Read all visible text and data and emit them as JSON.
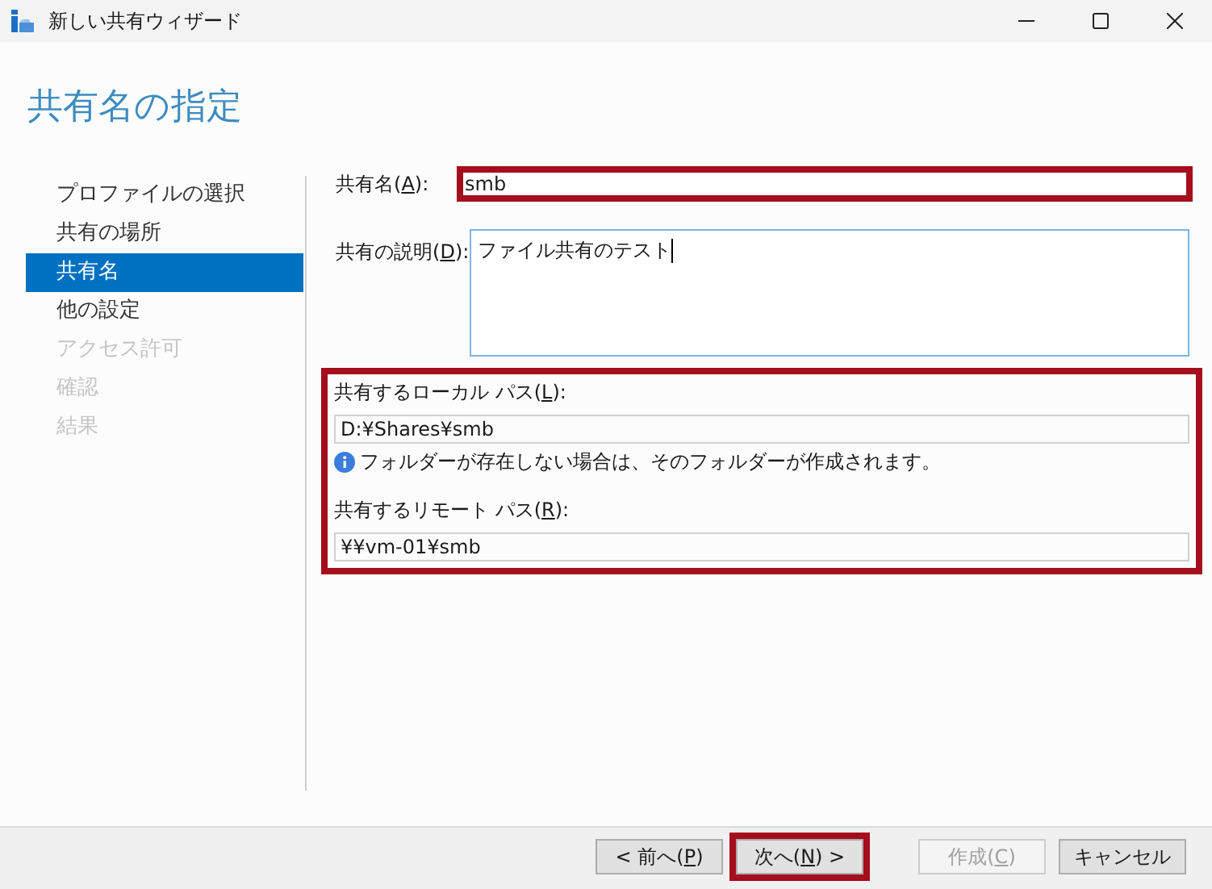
{
  "window": {
    "title": "新しい共有ウィザード"
  },
  "heading": "共有名の指定",
  "steps": [
    {
      "label": "プロファイルの選択",
      "selected": false,
      "disabled": false
    },
    {
      "label": "共有の場所",
      "selected": false,
      "disabled": false
    },
    {
      "label": "共有名",
      "selected": true,
      "disabled": false
    },
    {
      "label": "他の設定",
      "selected": false,
      "disabled": false
    },
    {
      "label": "アクセス許可",
      "selected": false,
      "disabled": true
    },
    {
      "label": "確認",
      "selected": false,
      "disabled": true
    },
    {
      "label": "結果",
      "selected": false,
      "disabled": true
    }
  ],
  "share_name": {
    "label": {
      "before": "共有名(",
      "key": "A",
      "after": "):"
    },
    "value": "smb",
    "highlighted": true
  },
  "description": {
    "label": {
      "before": "共有の説明(",
      "key": "D",
      "after": "):"
    },
    "value": "ファイル共有のテスト",
    "focused": true
  },
  "paths": {
    "highlighted": true,
    "local": {
      "label": {
        "before": "共有するローカル パス(",
        "key": "L",
        "after": "):"
      },
      "value": "D:¥Shares¥smb"
    },
    "info": "フォルダーが存在しない場合は、そのフォルダーが作成されます。",
    "remote": {
      "label": {
        "before": "共有するリモート パス(",
        "key": "R",
        "after": "):"
      },
      "value": "¥¥vm-01¥smb"
    }
  },
  "buttons": [
    {
      "label": {
        "before": "< 前へ(",
        "key": "P",
        "after": ")"
      },
      "disabled": false,
      "highlighted": false
    },
    {
      "label": {
        "before": "次へ(",
        "key": "N",
        "after": ") >"
      },
      "disabled": false,
      "highlighted": true
    },
    {
      "label": {
        "before": "作成(",
        "key": "C",
        "after": ")"
      },
      "disabled": true,
      "highlighted": false
    },
    {
      "label": {
        "before": "キャンセル"
      },
      "disabled": false,
      "highlighted": false
    }
  ]
}
